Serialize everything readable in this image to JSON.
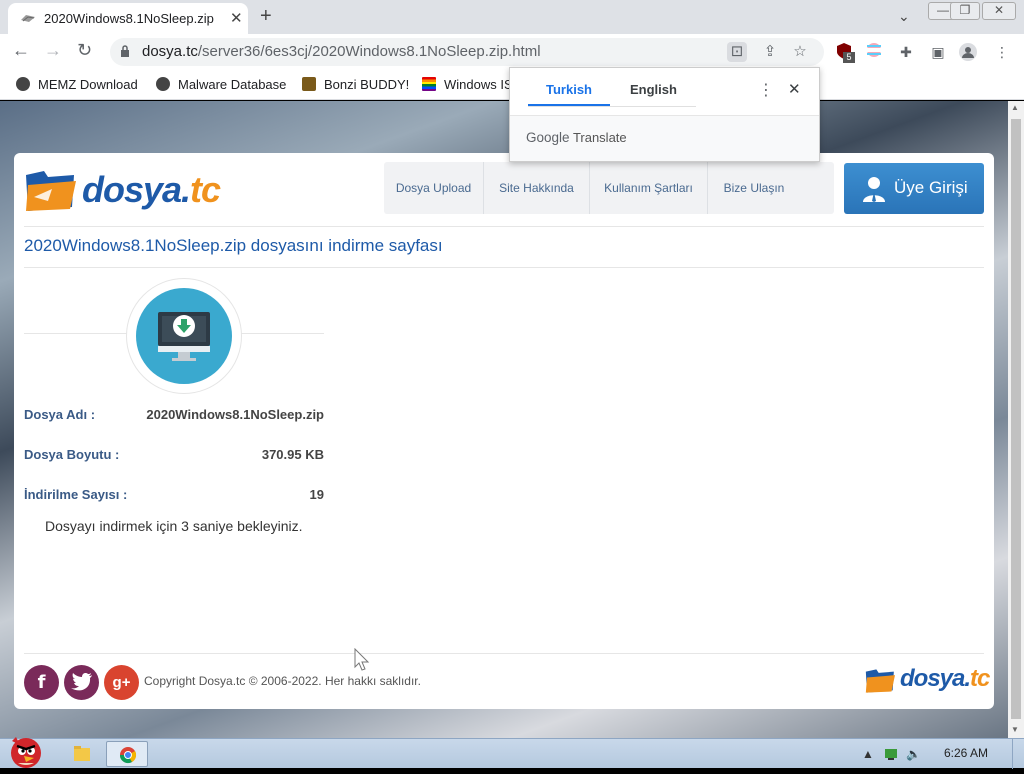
{
  "browser": {
    "tab_title": "2020Windows8.1NoSleep.zip",
    "url_host": "dosya.tc",
    "url_path": "/server36/6es3cj/2020Windows8.1NoSleep.zip.html",
    "extension_badge": "5",
    "bookmarks": [
      {
        "label": "MEMZ Download"
      },
      {
        "label": "Malware Database"
      },
      {
        "label": "Bonzi BUDDY!"
      },
      {
        "label": "Windows IS"
      }
    ]
  },
  "translate_popup": {
    "source_lang": "Turkish",
    "target_lang": "English",
    "brand_google": "Google",
    "brand_translate": "Translate"
  },
  "site": {
    "logo_main": "dosya.",
    "logo_tc": "tc",
    "nav": [
      "Dosya Upload",
      "Site Hakkında",
      "Kullanım Şartları",
      "Bize Ulaşın"
    ],
    "login_label": "Üye Girişi",
    "page_heading": "2020Windows8.1NoSleep.zip dosyasını indirme sayfası",
    "info": {
      "file_name_label": "Dosya Adı :",
      "file_name_value": "2020Windows8.1NoSleep.zip",
      "file_size_label": "Dosya Boyutu :",
      "file_size_value": "370.95 KB",
      "downloads_label": "İndirilme Sayısı :",
      "downloads_value": "19"
    },
    "wait_message": "Dosyayı indirmek için 3 saniye bekleyiniz.",
    "copyright": "Copyright Dosya.tc © 2006-2022. Her hakkı saklıdır.",
    "social": [
      "f",
      "g+"
    ]
  },
  "taskbar": {
    "clock": "6:26 AM"
  },
  "colors": {
    "brand_blue": "#1e5aa8",
    "brand_orange": "#f0921e",
    "download_circle": "#3aa9cf",
    "login_button": "#3d8fd1"
  }
}
